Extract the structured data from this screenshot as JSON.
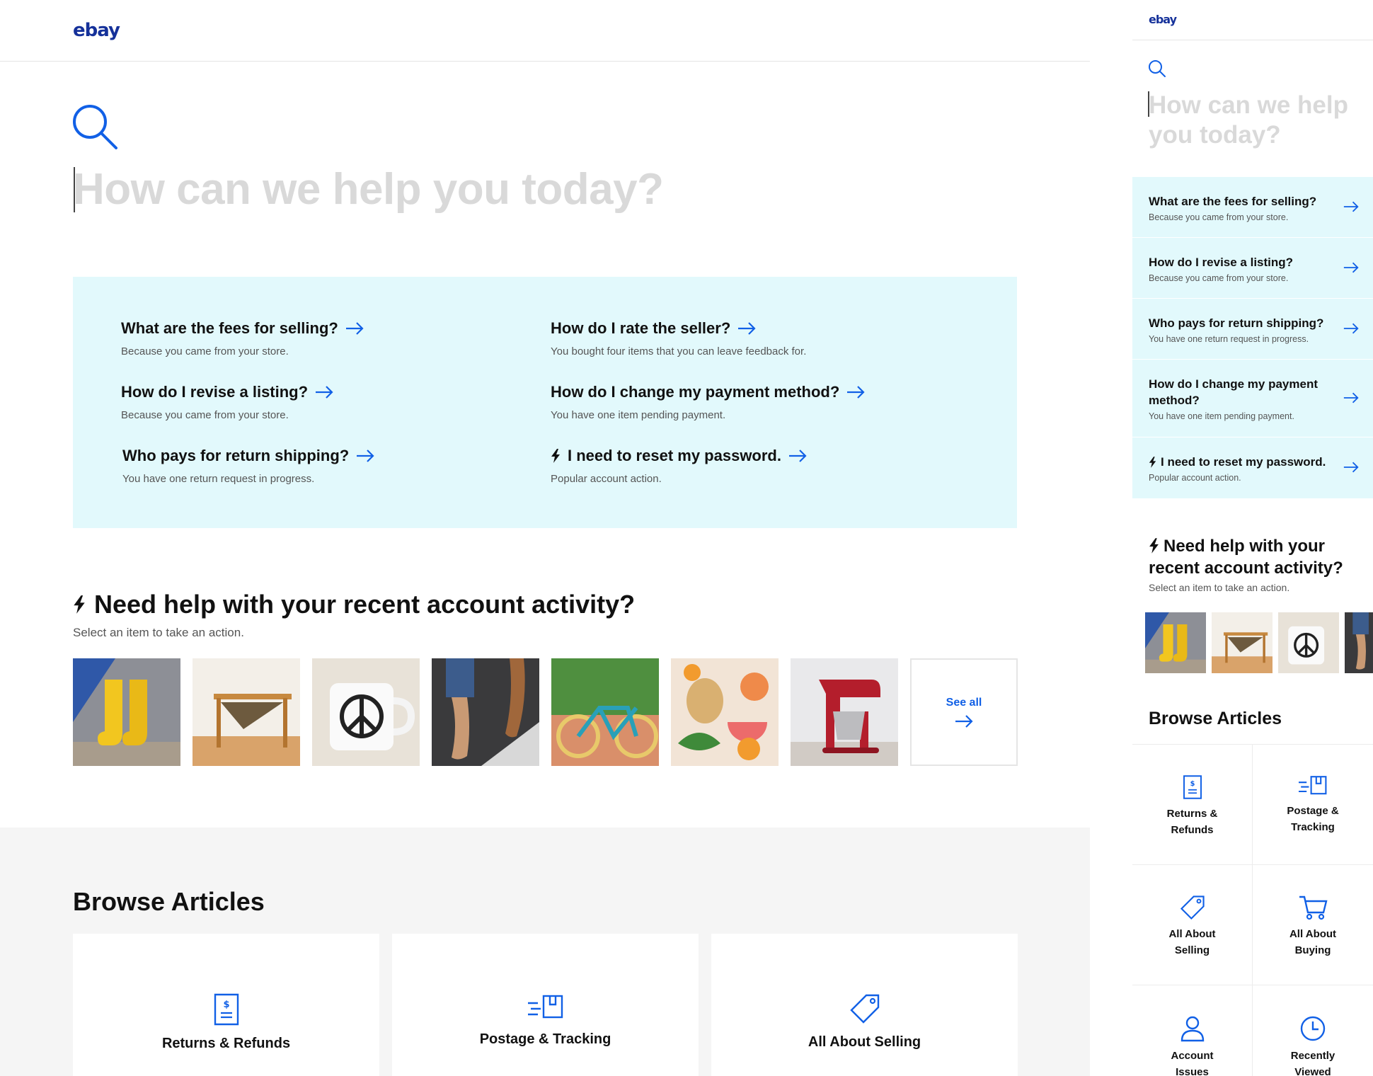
{
  "brand": {
    "logo": "ebay",
    "accent": "#1160e6",
    "panel_bg": "#e2f9fc"
  },
  "search": {
    "placeholder": "How can we help you today?"
  },
  "suggestions": [
    {
      "title": "What are the fees for selling?",
      "sub": "Because you came from your store.",
      "icon": ""
    },
    {
      "title": "How do I revise a listing?",
      "sub": "Because you came from your store.",
      "icon": ""
    },
    {
      "title": "Who pays for return shipping?",
      "sub": "You have one return request in progress.",
      "icon": ""
    },
    {
      "title": "How do I rate the seller?",
      "sub": "You bought four items that you can leave feedback for.",
      "icon": ""
    },
    {
      "title": "How do I change my payment method?",
      "sub": "You have one item pending payment.",
      "icon": ""
    },
    {
      "title": "I need to reset my password.",
      "sub": "Popular account action.",
      "icon": "lightning-icon"
    }
  ],
  "activity": {
    "title": "Need help with your recent account activity?",
    "subtitle": "Select an item to take an action.",
    "items": [
      "yellow-rain-boots",
      "wooden-magazine-stand",
      "peace-sign-mug",
      "leather-sandals",
      "teal-bicycle",
      "fruit-platter",
      "red-stand-mixer"
    ],
    "see_all": "See all"
  },
  "browse": {
    "title": "Browse Articles",
    "desktop_cards": [
      {
        "label": "Returns & Refunds",
        "icon": "receipt-icon"
      },
      {
        "label": "Postage & Tracking",
        "icon": "package-icon"
      },
      {
        "label": "All About Selling",
        "icon": "tag-icon"
      }
    ],
    "mobile_cells": [
      {
        "line1": "Returns &",
        "line2": "Refunds",
        "icon": "receipt-icon"
      },
      {
        "line1": "Postage &",
        "line2": "Tracking",
        "icon": "package-icon"
      },
      {
        "line1": "All About",
        "line2": "Selling",
        "icon": "tag-icon"
      },
      {
        "line1": "All About",
        "line2": "Buying",
        "icon": "cart-icon"
      },
      {
        "line1": "Account",
        "line2": "Issues",
        "icon": "person-icon"
      },
      {
        "line1": "Recently",
        "line2": "Viewed",
        "icon": "clock-icon"
      }
    ]
  },
  "mobile": {
    "query_line1": "How can we help",
    "query_line2": "you today?",
    "suggestions": [
      {
        "title": "What are the fees for selling?",
        "sub": "Because you came from your store."
      },
      {
        "title": "How do I revise a listing?",
        "sub": "Because you came from your store."
      },
      {
        "title": "Who pays for return shipping?",
        "sub": "You have one return request in progress."
      },
      {
        "title": "How do I change my payment method?",
        "sub": "You have one item pending payment."
      },
      {
        "title": "I need to reset my password.",
        "sub": "Popular account action."
      }
    ],
    "activity_title": "Need help with your recent account activity?",
    "activity_sub": "Select an item to take an action.",
    "browse_title": "Browse Articles"
  }
}
